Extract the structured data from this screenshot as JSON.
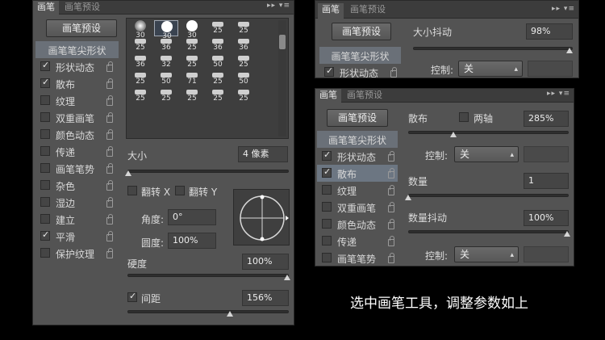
{
  "left_panel": {
    "tabs": [
      "画笔",
      "画笔预设"
    ],
    "preset_button": "画笔预设",
    "list_header": "画笔笔尖形状",
    "options": [
      {
        "label": "形状动态",
        "checked": true
      },
      {
        "label": "散布",
        "checked": true
      },
      {
        "label": "纹理",
        "checked": false
      },
      {
        "label": "双重画笔",
        "checked": false
      },
      {
        "label": "颜色动态",
        "checked": false
      },
      {
        "label": "传递",
        "checked": false
      },
      {
        "label": "画笔笔势",
        "checked": false
      },
      {
        "label": "杂色",
        "checked": false
      },
      {
        "label": "湿边",
        "checked": false
      },
      {
        "label": "建立",
        "checked": false
      },
      {
        "label": "平滑",
        "checked": true
      },
      {
        "label": "保护纹理",
        "checked": false
      }
    ],
    "brush_sizes": [
      "30",
      "30",
      "30",
      "25",
      "25",
      "25",
      "36",
      "25",
      "36",
      "36",
      "36",
      "32",
      "25",
      "50",
      "25",
      "25",
      "50",
      "71",
      "25",
      "50",
      "25",
      "25",
      "25",
      "25",
      "25"
    ],
    "size_label": "大小",
    "size_value": "4 像素",
    "flip_x_label": "翻转 X",
    "flip_y_label": "翻转 Y",
    "angle_label": "角度:",
    "angle_value": "0°",
    "roundness_label": "圆度:",
    "roundness_value": "100%",
    "hardness_label": "硬度",
    "hardness_value": "100%",
    "spacing_label": "间距",
    "spacing_value": "156%",
    "spacing_checked": true
  },
  "top_right_panel": {
    "tabs": [
      "画笔",
      "画笔预设"
    ],
    "preset_button": "画笔预设",
    "size_jitter_label": "大小抖动",
    "size_jitter_value": "98%",
    "list_header": "画笔笔尖形状",
    "shape_dynamics_label": "形状动态",
    "control_label": "控制:",
    "control_value": "关"
  },
  "bottom_right_panel": {
    "tabs": [
      "画笔",
      "画笔预设"
    ],
    "preset_button": "画笔预设",
    "scatter_label": "散布",
    "both_axes_label": "两轴",
    "scatter_value": "285%",
    "list_header": "画笔笔尖形状",
    "options": [
      {
        "label": "形状动态",
        "checked": true
      },
      {
        "label": "散布",
        "checked": true
      },
      {
        "label": "纹理",
        "checked": false
      },
      {
        "label": "双重画笔",
        "checked": false
      },
      {
        "label": "颜色动态",
        "checked": false
      },
      {
        "label": "传递",
        "checked": false
      },
      {
        "label": "画笔笔势",
        "checked": false
      }
    ],
    "control_label": "控制:",
    "control_value": "关",
    "count_label": "数量",
    "count_value": "1",
    "count_jitter_label": "数量抖动",
    "count_jitter_value": "100%",
    "control2_label": "控制:",
    "control2_value": "关"
  },
  "caption": "选中画笔工具，调整参数如上"
}
